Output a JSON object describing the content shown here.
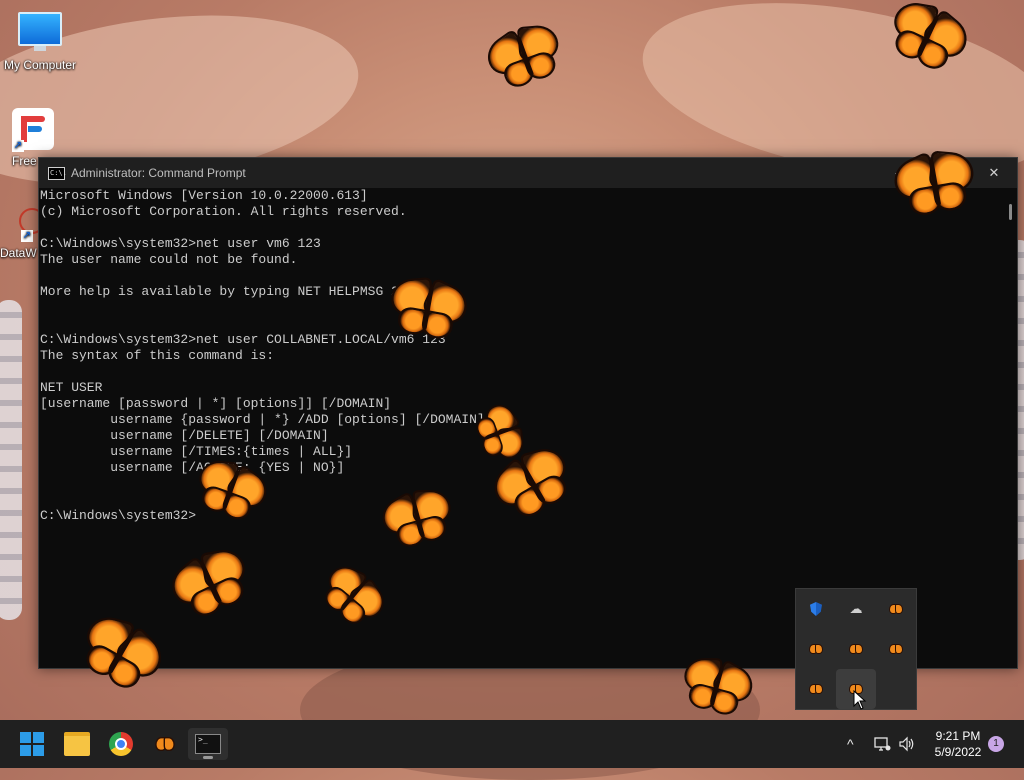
{
  "desktop": {
    "icons": [
      {
        "label": "My Computer"
      },
      {
        "label": "Free"
      },
      {
        "label": "DataW"
      }
    ]
  },
  "window": {
    "title": "Administrator: Command Prompt",
    "title_icon_text": "C:\\.",
    "buttons": {
      "minimize": "—",
      "maximize": "☐",
      "close": "✕"
    },
    "console_lines": [
      "Microsoft Windows [Version 10.0.22000.613]",
      "(c) Microsoft Corporation. All rights reserved.",
      "",
      "C:\\Windows\\system32>net user vm6 123",
      "The user name could not be found.",
      "",
      "More help is available by typing NET HELPMSG 2221.",
      "",
      "",
      "C:\\Windows\\system32>net user COLLABNET.LOCAL/vm6 123",
      "The syntax of this command is:",
      "",
      "NET USER",
      "[username [password | *] [options]] [/DOMAIN]",
      "         username {password | *} /ADD [options] [/DOMAIN]",
      "         username [/DELETE] [/DOMAIN]",
      "         username [/TIMES:{times | ALL}]",
      "         username [/ACTIVE: {YES | NO}]",
      "",
      "",
      "C:\\Windows\\system32>"
    ]
  },
  "taskbar": {
    "clock_time": "9:21 PM",
    "clock_date": "5/9/2022",
    "notification_count": "1",
    "chevron": "^"
  },
  "colors": {
    "console_bg": "#0c0c0c",
    "console_text": "#cccccc",
    "taskbar_bg": "#202020",
    "windows_blue": "#2c9ce8"
  }
}
